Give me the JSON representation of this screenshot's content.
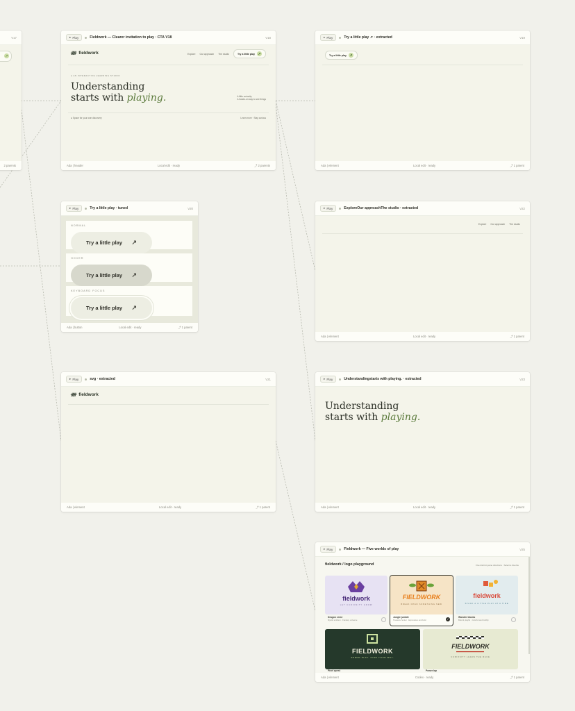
{
  "common": {
    "play_label": "Play",
    "local_status": "Local edit · ready"
  },
  "card_left_partial": {
    "version": "V17",
    "foot_right": "2 parents"
  },
  "card_main": {
    "title": "Fieldwork — Clearer invitation to play · CTA V18",
    "version": "V18",
    "foot_left": "Ada | header",
    "foot_right": "2 parents",
    "brand": "fieldwork",
    "nav": [
      "Explore",
      "Our approach",
      "The studio"
    ],
    "cta": "Try a little play",
    "eyebrow": "● AN INTERACTIVE LEARNING STUDIO",
    "headline_1": "Understanding",
    "headline_2": "starts with",
    "headline_em": "playing.",
    "aside_1": "A little curiosity",
    "aside_2": "A hands-on way to see things",
    "bottom_left": "Space for your own discovery",
    "bottom_right": "Learn more · Stay curious"
  },
  "card_extract_cta": {
    "title": "Try a little play ↗ · extracted",
    "version": "V19",
    "foot_left": "Ada | element",
    "foot_right": "1 parent",
    "button": "Try a little play"
  },
  "card_tuned": {
    "title": "Try a little play · tuned",
    "version": "V20",
    "foot_left": "Ada | button",
    "foot_right": "1 parent",
    "states": [
      {
        "label": "NORMAL",
        "button": "Try a little play"
      },
      {
        "label": "HOVER",
        "button": "Try a little play"
      },
      {
        "label": "KEYBOARD FOCUS",
        "button": "Try a little play"
      }
    ]
  },
  "card_extract_nav": {
    "title": "ExploreOur approachThe studio · extracted",
    "version": "V22",
    "foot_left": "Ada | element",
    "foot_right": "1 parent",
    "nav": [
      "Explore",
      "Our approach",
      "The studio"
    ]
  },
  "card_svg": {
    "title": "svg · extracted",
    "version": "V21",
    "foot_left": "Ada | element",
    "foot_right": "1 parent",
    "brand": "fieldwork"
  },
  "card_headline": {
    "title": "Understandingstarts with playing. · extracted",
    "version": "V23",
    "foot_left": "Ada | element",
    "foot_right": "1 parent",
    "line_1": "Understanding",
    "line_2": "starts with",
    "em": "playing."
  },
  "card_logos": {
    "title": "Fieldwork — Five worlds of play",
    "version": "V25",
    "foot_left": "Ada | element",
    "foot_status": "Codex · ready",
    "foot_right": "1 parent",
    "heading": "fieldwork / logo playground",
    "heading_right": "Five distinct game directions · Select a favorite",
    "tiles": [
      {
        "word": "fieldwork",
        "tag": "LET CURIOSITY GROW",
        "name": "Dragon crest",
        "sub": "Mystic emblem · Fantasy universe",
        "bg": "#e7e2f3"
      },
      {
        "word": "FIELDWORK",
        "tag": "BREAK OPEN SOMETHING NEW",
        "name": "Jungle jumble",
        "sub": "Treasure hunter · Expressive and bold",
        "bg": "#f6e4c6"
      },
      {
        "word": "fieldwork",
        "tag": "STACK A LITTLE PLAY AT A TIME",
        "name": "Wonder blocks",
        "sub": "Bold & playful · Colorful and bubbly",
        "bg": "#e2ecee"
      },
      {
        "word": "FIELDWORK",
        "tag": "SPEND PLAY. FIND YOUR WAY.",
        "name": "Pixel quest",
        "sub": "",
        "bg": "#25392b"
      },
      {
        "word": "FIELDWORK",
        "tag": "CURIOSITY LEADS THE RACE",
        "name": "Power lap",
        "sub": "",
        "bg": "#e7ead2"
      }
    ]
  }
}
